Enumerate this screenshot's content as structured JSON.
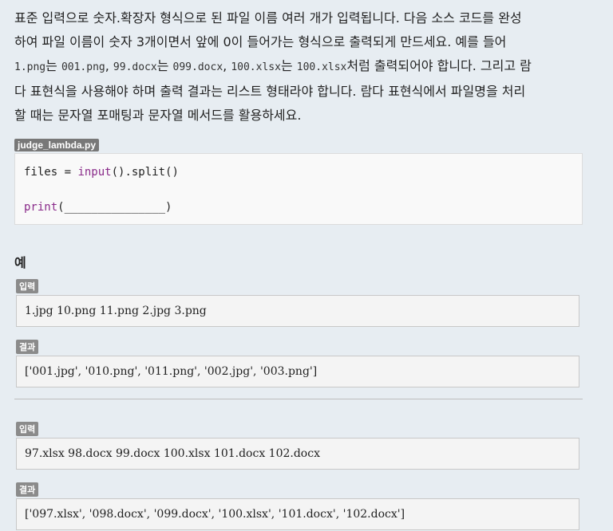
{
  "description": {
    "line1": "표준 입력으로 숫자.확장자 형식으로 된 파일 이름 여러 개가 입력됩니다. 다음 소스 코드를 완성",
    "line2": "하여 파일 이름이 숫자 3개이면서 앞에 0이 들어가는 형식으로 출력되게 만드세요. 예를 들어",
    "line3_code1": "1.png",
    "line3_t1": "는 ",
    "line3_code2": "001.png",
    "line3_t2": ", ",
    "line3_code3": "99.docx",
    "line3_t3": "는 ",
    "line3_code4": "099.docx",
    "line3_t4": ", ",
    "line3_code5": "100.xlsx",
    "line3_t5": "는 ",
    "line3_code6": "100.xlsx",
    "line3_t6": "처럼 출력되어야 합니다. 그리고 람",
    "line4": "다 표현식을 사용해야 하며 출력 결과는 리스트 형태라야 합니다. 람다 표현식에서 파일명을 처리",
    "line5": "할 때는 문자열 포매팅과 문자열 메서드를 활용하세요."
  },
  "code_file": {
    "filename": "judge_lambda.py",
    "line1_a": "files = ",
    "line1_fn": "input",
    "line1_b": "().split()",
    "line2_fn": "print",
    "line2_b": "(_______________)"
  },
  "examples": {
    "heading": "예",
    "input_label": "입력",
    "output_label": "결과",
    "items": [
      {
        "input": "1.jpg 10.png 11.png 2.jpg 3.png",
        "output": "['001.jpg', '010.png', '011.png', '002.jpg', '003.png']"
      },
      {
        "input": "97.xlsx 98.docx 99.docx 100.xlsx 101.docx 102.docx",
        "output": "['097.xlsx', '098.docx', '099.docx', '100.xlsx', '101.docx', '102.docx']"
      }
    ]
  }
}
